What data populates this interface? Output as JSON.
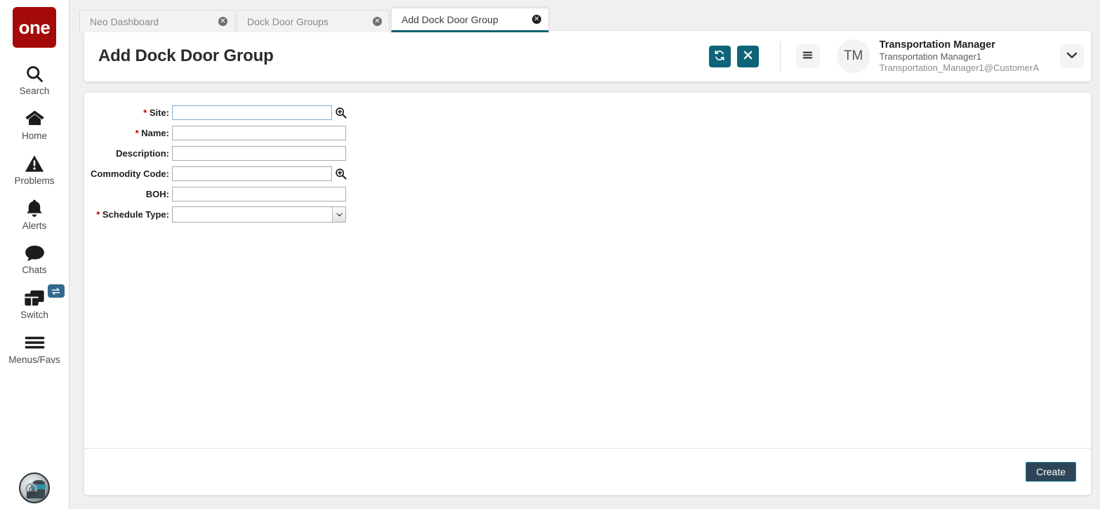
{
  "app": {
    "logo_text": "one",
    "brand_color": "#a50a0a",
    "accent_teal": "#0d6478",
    "create_btn_color": "#2e4559"
  },
  "sidebar": {
    "items": [
      {
        "label": "Search",
        "icon": "search-icon"
      },
      {
        "label": "Home",
        "icon": "home-icon"
      },
      {
        "label": "Problems",
        "icon": "warning-triangle-icon"
      },
      {
        "label": "Alerts",
        "icon": "bell-icon"
      },
      {
        "label": "Chats",
        "icon": "chat-bubble-icon"
      },
      {
        "label": "Switch",
        "icon": "windows-stack-icon",
        "badge_icon": "swap-arrows-icon"
      },
      {
        "label": "Menus/Favs",
        "icon": "hamburger-icon"
      }
    ],
    "bottom_avatar_icon": "assistant-robot-icon"
  },
  "tabs": [
    {
      "label": "Neo Dashboard",
      "active": false,
      "close_icon": "close-circle-icon"
    },
    {
      "label": "Dock Door Groups",
      "active": false,
      "close_icon": "close-circle-icon"
    },
    {
      "label": "Add Dock Door Group",
      "active": true,
      "close_icon": "close-circle-icon"
    }
  ],
  "header": {
    "title": "Add Dock Door Group",
    "refresh_icon": "refresh-icon",
    "close_icon": "close-x-icon",
    "menu_icon": "hamburger-menu-icon",
    "caret_icon": "chevron-down-icon",
    "avatar_initials": "TM",
    "user_role": "Transportation Manager",
    "user_name": "Transportation Manager1",
    "user_email": "Transportation_Manager1@CustomerA"
  },
  "form": {
    "fields": [
      {
        "label": "Site:",
        "required": true,
        "value": "",
        "type": "lookup",
        "focused": true,
        "lookup_icon": "magnifier-plus-icon"
      },
      {
        "label": "Name:",
        "required": true,
        "value": "",
        "type": "text"
      },
      {
        "label": "Description:",
        "required": false,
        "value": "",
        "type": "text"
      },
      {
        "label": "Commodity Code:",
        "required": false,
        "value": "",
        "type": "lookup",
        "lookup_icon": "magnifier-plus-icon"
      },
      {
        "label": "BOH:",
        "required": false,
        "value": "",
        "type": "text"
      },
      {
        "label": "Schedule Type:",
        "required": true,
        "value": "",
        "type": "select",
        "options": [
          ""
        ]
      }
    ]
  },
  "footer": {
    "create_label": "Create"
  }
}
